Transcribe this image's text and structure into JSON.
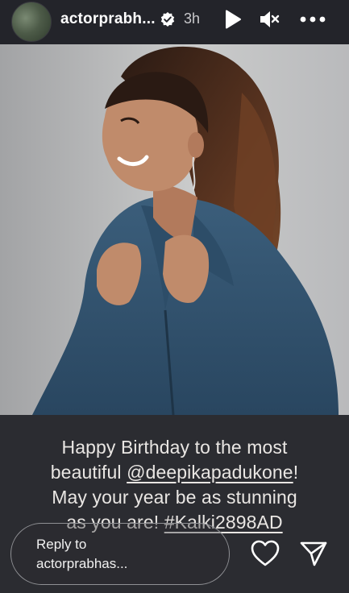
{
  "header": {
    "username": "actorprabh...",
    "time": "3h"
  },
  "icons": {
    "verified": "verified-badge-icon",
    "play": "play-icon",
    "mute": "muted-speaker-icon",
    "more": "more-options-icon",
    "like": "heart-icon",
    "share": "send-icon"
  },
  "caption": {
    "line1": "Happy Birthday to the most",
    "line2_prefix": "beautiful ",
    "mention": "@deepikapadukone",
    "line2_suffix": "!",
    "line3": "May your year be as stunning",
    "line4_prefix": "as you are! ",
    "hashtag": "#Kalki2898AD"
  },
  "reply": {
    "line1": "Reply to",
    "line2": "actorprabhas..."
  },
  "colors": {
    "background": "#2b2c31",
    "header": "#23242a",
    "text": "#e9e6e3"
  }
}
